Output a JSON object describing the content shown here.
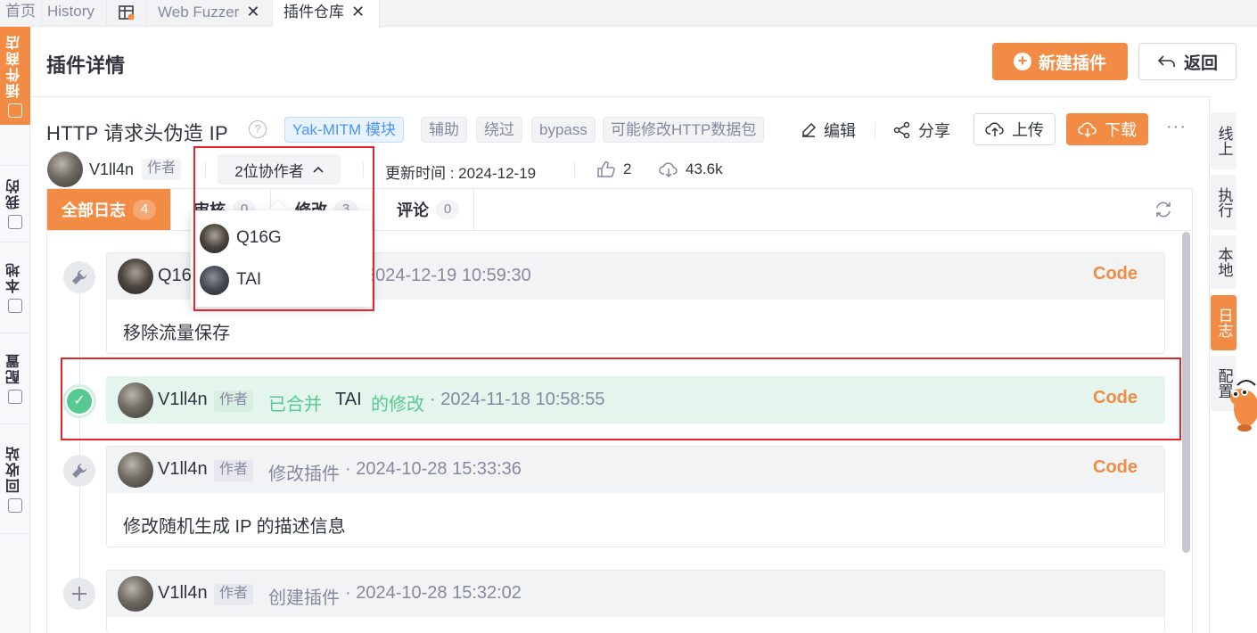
{
  "tabs": [
    {
      "label": "首页"
    },
    {
      "label": "History"
    },
    {
      "label": "",
      "icon": "table-icon"
    },
    {
      "label": "Web Fuzzer"
    },
    {
      "label": "插件仓库"
    }
  ],
  "left_nav": [
    {
      "label": "插件商店"
    },
    {
      "label": "我的"
    },
    {
      "label": "本地"
    },
    {
      "label": "配置"
    },
    {
      "label": "回收站"
    }
  ],
  "header": {
    "title": "插件详情",
    "new_button": "新建插件",
    "back_button": "返回"
  },
  "plugin": {
    "title": "HTTP 请求头伪造 IP",
    "type_tag": "Yak-MITM 模块",
    "tags": [
      "辅助",
      "绕过",
      "bypass",
      "可能修改HTTP数据包"
    ],
    "edit": "编辑",
    "share": "分享",
    "upload": "上传",
    "download": "下载",
    "author": "V1ll4n",
    "author_badge": "作者",
    "coauthors_button": "2位协作者",
    "updated": "更新时间 : 2024-12-19",
    "likes": "2",
    "downloads": "43.6k"
  },
  "log_tabs": [
    {
      "label": "全部日志",
      "count": "4"
    },
    {
      "label": "审核",
      "count": "0"
    },
    {
      "label": "修改",
      "count": "3"
    },
    {
      "label": "评论",
      "count": "0"
    }
  ],
  "logs": [
    {
      "user": "Q16G",
      "action": "",
      "time": "2024-12-19 10:59:30",
      "code": "Code",
      "body": "移除流量保存"
    },
    {
      "user": "V1ll4n",
      "badge": "作者",
      "action": "已合并",
      "target": "TAI",
      "action_suffix": "的修改",
      "time": "· 2024-11-18 10:58:55",
      "code": "Code"
    },
    {
      "user": "V1ll4n",
      "badge": "作者",
      "action": "修改插件",
      "time": "· 2024-10-28 15:33:36",
      "code": "Code",
      "body": "修改随机生成 IP 的描述信息"
    },
    {
      "user": "V1ll4n",
      "badge": "作者",
      "action": "创建插件",
      "time": "· 2024-10-28 15:32:02"
    }
  ],
  "coauthors": [
    "Q16G",
    "TAI"
  ],
  "right_tabs": [
    "线上",
    "执行",
    "本地",
    "日志",
    "配置"
  ],
  "colors": {
    "accent": "#f28b44",
    "success": "#56c991",
    "highlight": "#e3262b"
  }
}
